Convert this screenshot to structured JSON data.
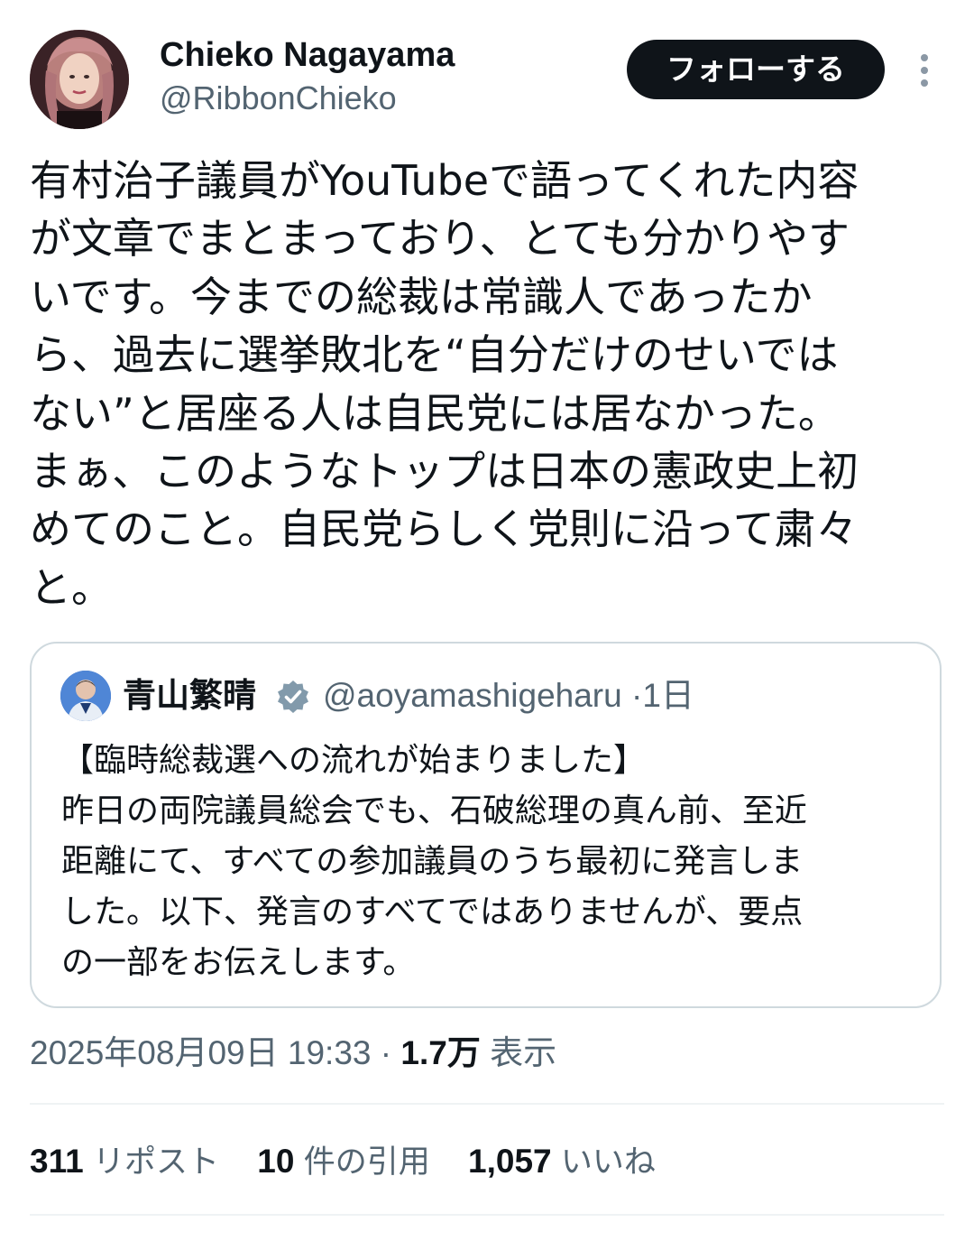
{
  "author": {
    "display_name": "Chieko Nagayama",
    "handle": "@RibbonChieko",
    "avatar_icon": "profile-photo-avatar"
  },
  "follow_label": "フォローする",
  "more_icon": "more-vertical-icon",
  "tweet_text": "有村治子議員がYouTubeで語ってくれた内容\nが文章でまとまっており、とても分かりやす\nいです。今までの総裁は常識人であったか\nら、過去に選挙敗北を“自分だけのせいでは\nない”と居座る人は自民党には居なかった。\nまぁ、このようなトップは日本の憲政史上初\nめてのこと。自民党らしく党則に沿って粛々\nと。",
  "quote": {
    "display_name": "青山繁晴",
    "verified": true,
    "handle": "@aoyamashigeharu",
    "separator": "·",
    "age": "1日",
    "text": "【臨時総裁選への流れが始まりました】\n昨日の両院議員総会でも、石破総理の真ん前、至近\n距離にて、すべての参加議員のうち最初に発言しま\nした。以下、発言のすべてではありませんが、要点\nの一部をお伝えします。"
  },
  "meta": {
    "timestamp": "2025年08月09日 19:33",
    "separator": "·",
    "views_count": "1.7万",
    "views_label": "表示"
  },
  "stats": {
    "reposts_count": "311",
    "reposts_label": "リポスト",
    "quotes_count": "10",
    "quotes_label": "件の引用",
    "likes_count": "1,057",
    "likes_label": "いいね"
  },
  "colors": {
    "text_primary": "#0f1419",
    "text_secondary": "#536471",
    "border": "#cfd9de",
    "divider": "#eff3f4",
    "follow_button_bg": "#0f1419",
    "verified_badge": "#829aab"
  }
}
